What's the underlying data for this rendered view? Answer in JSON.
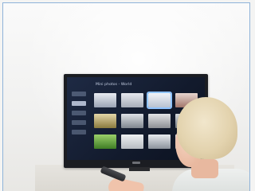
{
  "tv_screen": {
    "title": "Mini photos - World",
    "sidebar_item_count_visual": 5,
    "tiles": [
      {
        "color_top": "#e9ecf2",
        "color_bottom": "#9aa3b4"
      },
      {
        "color_top": "#e6e8ee",
        "color_bottom": "#a7adb8"
      },
      {
        "color_top": "#f1f3f7",
        "color_bottom": "#b9c2d1"
      },
      {
        "color_top": "#e7d6cf",
        "color_bottom": "#a2766b"
      },
      {
        "color_top": "#e5d7a8",
        "color_bottom": "#8a7a3e"
      },
      {
        "color_top": "#dfe2e6",
        "color_bottom": "#7f868f"
      },
      {
        "color_top": "#e3e4e6",
        "color_bottom": "#8d8f94"
      },
      {
        "color_top": "#d7dade",
        "color_bottom": "#6f757d"
      },
      {
        "color_top": "#9bd06a",
        "color_bottom": "#3f7d25"
      },
      {
        "color_top": "#eef0f2",
        "color_bottom": "#b7bcc2"
      },
      {
        "color_top": "#e7eaee",
        "color_bottom": "#8b929c"
      },
      {
        "color_top": "#dfe3e8",
        "color_bottom": "#a0a7b1"
      }
    ],
    "selected_tile_index": 2
  },
  "colors": {
    "frame_border": "#8fb3d9",
    "screen_bg": "#1e2a44",
    "highlight": "#8fc3ff"
  }
}
